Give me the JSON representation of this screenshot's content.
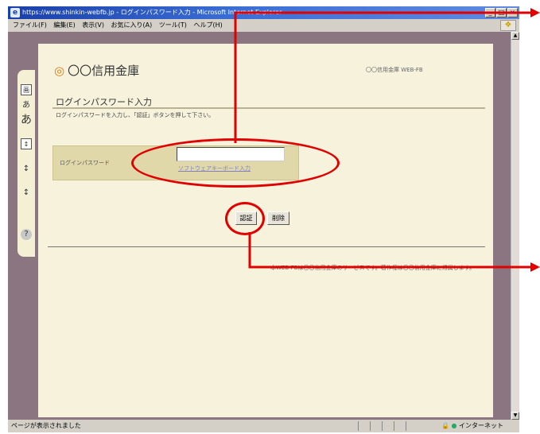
{
  "window": {
    "title": "https://www.shinkin-webfb.jp - ログインパスワード入力 - Microsoft Internet Explorer",
    "buttons": [
      "_",
      "□",
      "×"
    ]
  },
  "menu": {
    "items": [
      "ファイル(F)",
      "編集(E)",
      "表示(V)",
      "お気に入り(A)",
      "ツール(T)",
      "ヘルプ(H)"
    ]
  },
  "sidebar": {
    "buttons": [
      "画",
      "あ",
      "あ",
      "↕",
      "↕",
      "↕",
      "?"
    ]
  },
  "header": {
    "logo_mark": "◎",
    "bank_name": "〇〇信用金庫",
    "service_name": "〇〇信用金庫 WEB-FB"
  },
  "main": {
    "section_title": "ログインパスワード入力",
    "instruction": "ログインパスワードを入力し、「認証」ボタンを押して下さい。",
    "password": {
      "label": "ログインパスワード",
      "value": "",
      "software_keyboard_link": "ソフトウェアキーボード入力"
    },
    "auth_button": "認証",
    "delete_button": "削除",
    "footer_note": "本WEB-FBは〇〇信用金庫のサービスです。著作権は〇〇信用金庫に帰属します。"
  },
  "status": {
    "left_text": "ページが表示されました",
    "zone": "インターネット"
  },
  "annotation_color": "#e00000"
}
